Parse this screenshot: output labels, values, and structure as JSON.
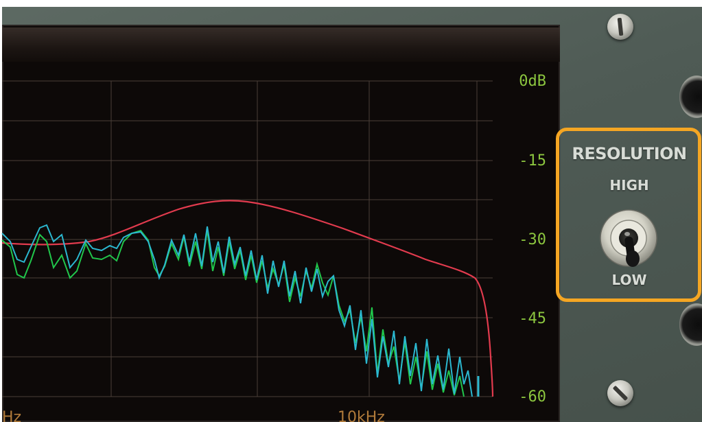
{
  "spectrum": {
    "db_scale": [
      "0dB",
      "-15",
      "-30",
      "-45",
      "-60"
    ],
    "freq_labels": [
      "Hz",
      "10kHz"
    ],
    "colors": {
      "label_green": "#8cc63f",
      "reference_curve": "#e23b4e",
      "channel_left": "#21c64b",
      "channel_right": "#2bb8d0",
      "grid": "#4a3f39"
    }
  },
  "resolution": {
    "title": "RESOLUTION",
    "high_label": "HIGH",
    "low_label": "LOW",
    "selected": "LOW",
    "highlight_color": "#f5a623"
  },
  "icons": {
    "screws": [
      "screw-icon",
      "screw-icon"
    ],
    "jacks": [
      "jack-icon",
      "jack-icon"
    ]
  }
}
